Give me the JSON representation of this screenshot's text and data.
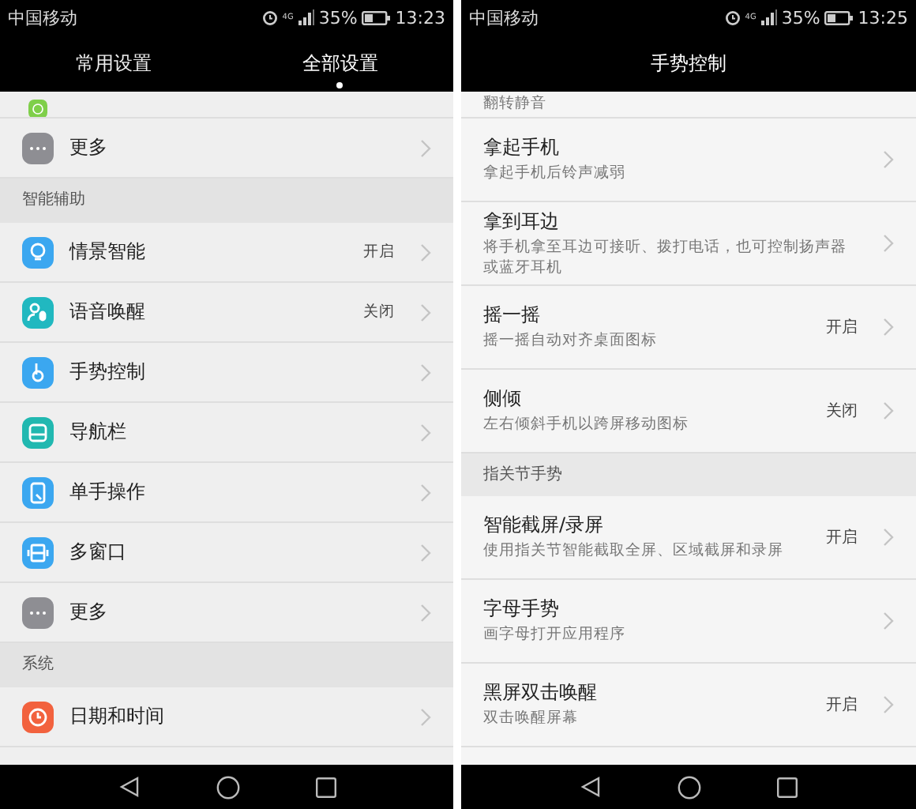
{
  "screens": [
    {
      "status_bar": {
        "carrier": "中国移动",
        "network": "4G",
        "battery": "35%",
        "time": "13:23"
      },
      "header": {
        "tabs": [
          {
            "label": "常用设置",
            "selected": false
          },
          {
            "label": "全部设置",
            "selected": true
          }
        ]
      },
      "sections": [
        {
          "items": [
            {
              "kind": "partial",
              "color": "#7fcf4a"
            },
            {
              "label": "更多",
              "kind": "more",
              "color": "#8e8e93"
            }
          ]
        },
        {
          "title": "智能辅助",
          "items": [
            {
              "label": "情景智能",
              "value": "开启",
              "kind": "bulb",
              "color": "#3ba7f0"
            },
            {
              "label": "语音唤醒",
              "value": "关闭",
              "kind": "voice",
              "color": "#21b8c0"
            },
            {
              "label": "手势控制",
              "kind": "hand",
              "color": "#3ba7f0"
            },
            {
              "label": "导航栏",
              "kind": "nav",
              "color": "#21b8b0"
            },
            {
              "label": "单手操作",
              "kind": "onehand",
              "color": "#3ba7f0"
            },
            {
              "label": "多窗口",
              "kind": "window",
              "color": "#3ba7f0"
            },
            {
              "label": "更多",
              "kind": "more",
              "color": "#8e8e93"
            }
          ]
        },
        {
          "title": "系统",
          "items": [
            {
              "label": "日期和时间",
              "kind": "clock",
              "color": "#f2623e"
            }
          ]
        }
      ]
    },
    {
      "status_bar": {
        "carrier": "中国移动",
        "network": "4G",
        "battery": "35%",
        "time": "13:25"
      },
      "header": {
        "title": "手势控制"
      },
      "sections": [
        {
          "items": [
            {
              "subtitle": "翻转静音"
            },
            {
              "label": "拿起手机",
              "subtitle": "拿起手机后铃声减弱"
            },
            {
              "label": "拿到耳边",
              "subtitle": "将手机拿至耳边可接听、拨打电话，也可控制扬声器或蓝牙耳机"
            },
            {
              "label": "摇一摇",
              "subtitle": "摇一摇自动对齐桌面图标",
              "value": "开启"
            },
            {
              "label": "侧倾",
              "subtitle": "左右倾斜手机以跨屏移动图标",
              "value": "关闭"
            }
          ]
        },
        {
          "title": "指关节手势",
          "items": [
            {
              "label": "智能截屏/录屏",
              "subtitle": "使用指关节智能截取全屏、区域截屏和录屏",
              "value": "开启"
            },
            {
              "label": "字母手势",
              "subtitle": "画字母打开应用程序"
            },
            {
              "label": "黑屏双击唤醒",
              "subtitle": "双击唤醒屏幕",
              "value": "开启"
            }
          ]
        }
      ]
    }
  ]
}
